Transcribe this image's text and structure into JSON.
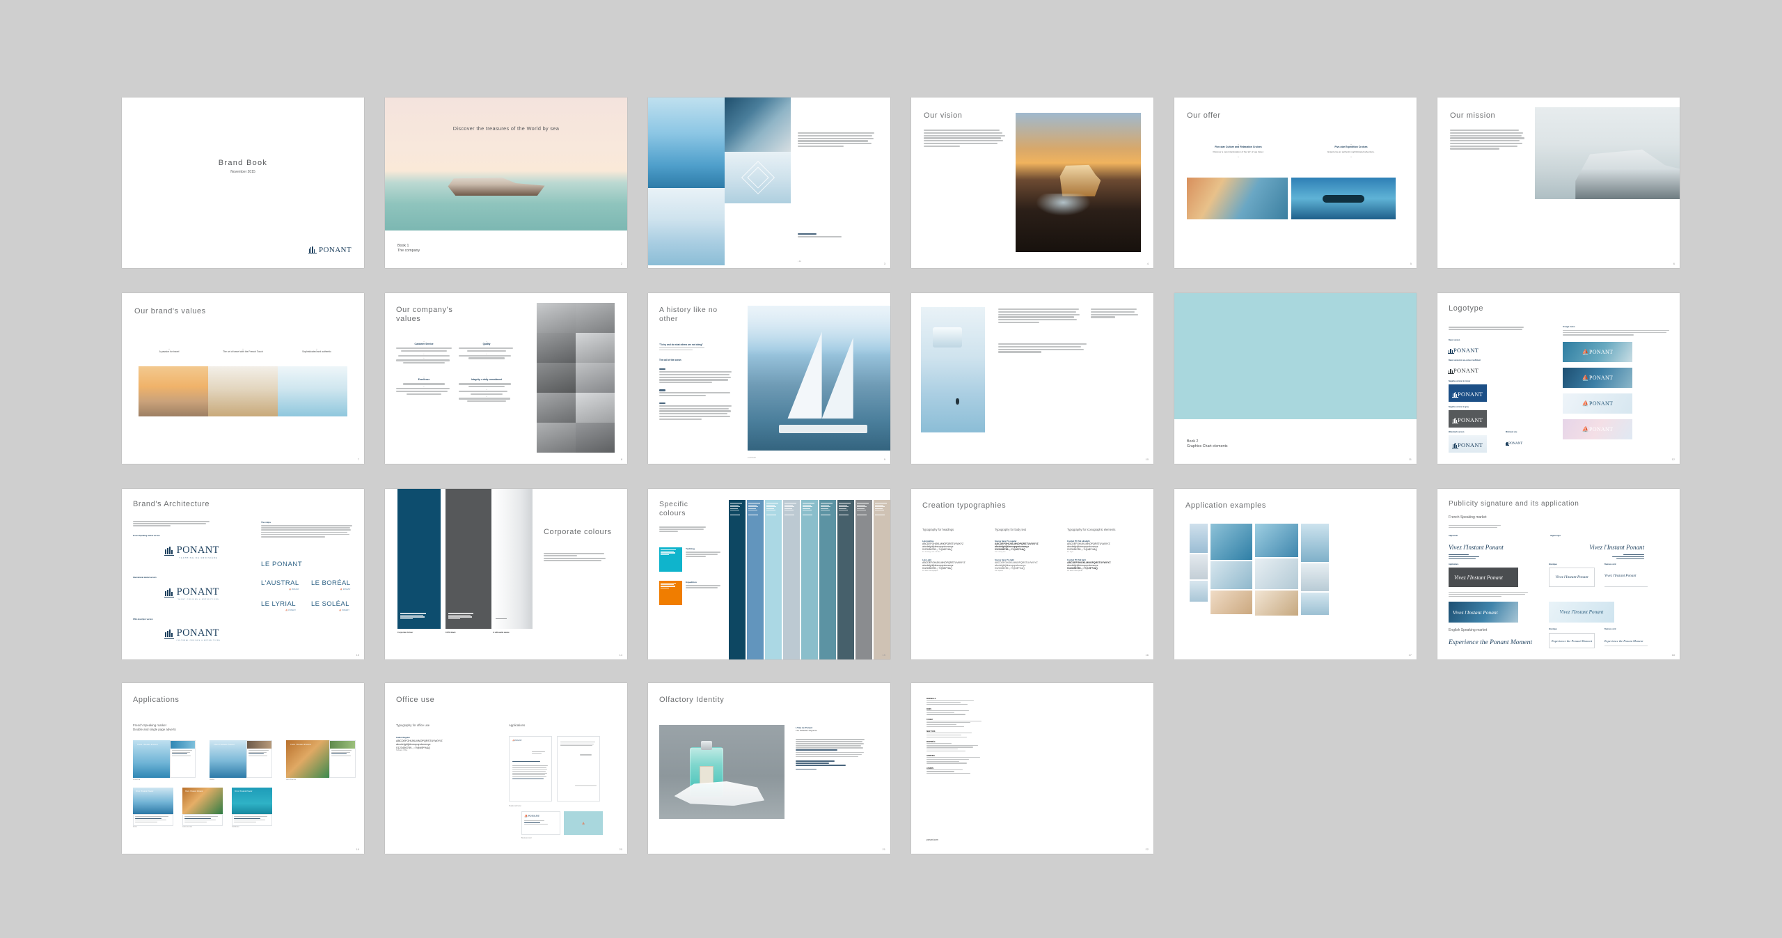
{
  "document": {
    "title": "Brand Book",
    "date": "November 2015",
    "brand": "PONANT",
    "accent_blue": "#1b3e5c",
    "accent_cyan": "#0fb4cc",
    "accent_orange": "#f07d00",
    "accent_lightblue": "#a9d7dd",
    "page_bg": "#cfcfcf",
    "website": "ponant.com"
  },
  "slides": [
    {
      "n": 1,
      "name": "cover",
      "title": "Brand Book",
      "subtitle": "November 2015",
      "logo": "PONANT",
      "page": ""
    },
    {
      "n": 2,
      "name": "book-1-divider",
      "tagline": "Discover the treasures of the World by sea",
      "book_label": "Book 1",
      "book_title": "The company",
      "page": "2"
    },
    {
      "n": 3,
      "name": "imagery-mosaic",
      "body": "PONANT offers a unique way of travelling: small capacity luxury yachts sailing to the most beautiful destinations in the world, combining comfort, design and the French Touch.",
      "caption": "Le monde",
      "page": "3"
    },
    {
      "n": 4,
      "name": "our-vision",
      "title": "Our vision",
      "body": "To become for France and our international target markets the benchmark for a new style of luxury cruise. In the spirit of a 'Yacht Cruise' they stand out for quality and a varied, carefully thought-out programme of exceptional voyages at sea.",
      "page": "4"
    },
    {
      "n": 5,
      "name": "our-offer",
      "title": "Our offer",
      "columns": [
        {
          "heading": "Five-star Culture and Relaxation Cruises",
          "body": "Discover a new interpretation of the 'art' of sea travel."
        },
        {
          "heading": "Five-star Expedition Cruises",
          "body": "Experience an authentic sophisticated adventure."
        }
      ],
      "page": "5"
    },
    {
      "n": 6,
      "name": "our-mission",
      "title": "Our mission",
      "body": "Offer passengers an opportunity to 'Discover the treasures of the World by sea' aboard small capacity luxury yachts, accompanied by experts passionate about what they do, in a five-star environment combining comfort, design and the French Touch, a certain 'art de vivre à la française'.",
      "page": "6"
    },
    {
      "n": 7,
      "name": "our-brands-values",
      "title": "Our brand's values",
      "values": [
        "A passion for travel",
        "The art of travel with the French Touch",
        "Sophisticated and authentic"
      ],
      "page": "7"
    },
    {
      "n": 8,
      "name": "our-companys-values",
      "title": "Our company's values",
      "values": [
        {
          "heading": "Customer Service",
          "items": [
            "Ensuring customer satisfaction by listening and exceeding their expectations.",
            "Offering the service and experience we'd wish to receive.",
            "Providing a reliable and consistently high quality service for frequent travellers (repeat and loyalty programmes)."
          ]
        },
        {
          "heading": "Quality",
          "items": [
            "Constantly striving for excellence in everything we do and expect of each other.",
            "Paying attention to and belief in detail which makes the difference."
          ]
        },
        {
          "heading": "Excellence",
          "items": [
            "Employing the best people.",
            "Investing in developing their potential (career, training, recognition, rewarding performance and sharing success)."
          ]
        },
        {
          "heading": "Integrity: a daily commitment",
          "items": [
            "Behaving in an ethical and responsible manner for all our crew.",
            "Fully respecting our passengers and the ocean.",
            "Contributing to protecting the environment and local communities."
          ]
        }
      ],
      "page": "8"
    },
    {
      "n": 9,
      "name": "a-history-like-no-other",
      "title": "A history like no other",
      "quote": "\"To try and do what others are not doing\"",
      "quote_attribution": "J.E. Olivier (1937 – 2010), the original founder and prime explorer",
      "section": "The call of the ocean",
      "timeline": [
        {
          "year": "1988",
          "text": "Created in 1988 by a few PONANT officers led by former naval Captains, the company launched its first cruise ship, Le Ponant, a four-masted sailing yacht. The idea was to offer an alternative to the existing mass market offer and provide a unique experience at sea."
        },
        {
          "year": "1993",
          "text": "In 1993, the company acquired the Song of Flower and its Mediterranean and Far East itineraries."
        },
        {
          "year": "2004",
          "text": "Three ships joined the fleet between 2010 and 2013: Le Boréal, L'Austral and Le Soléal. In 2015 Le Lyrial joined the fleet, reinforcing the yacht-cruise concept designed for elegance and comfort. The company continued to grow with its purpose-built fleet of expedition yachts, opening new destinations including the Arctic and Antarctic."
        }
      ],
      "caption": "Le Ponant",
      "page": "9"
    },
    {
      "n": 10,
      "name": "expedition-spread",
      "body": "Expedition cruises take you to the furthest reaches of the planet, to destinations where few travellers venture, in the heart of unspoiled nature and in complete comfort.",
      "page": "10"
    },
    {
      "n": 11,
      "name": "book-2-divider",
      "book_label": "Book 2",
      "book_title": "Graphics Chart elements",
      "page": "11"
    },
    {
      "n": 12,
      "name": "logotype",
      "title": "Logotype",
      "intro": "The logotype represents the image of the brand. It is an indispensable element of the brand's identity. Its proportions, positioning and colours of the mark are predefined and must never be altered.",
      "variants": [
        "Basic version",
        "Basic version in one-colour coefficient",
        "Negative version in colour",
        "Negative version in grey",
        "Watermark version",
        "Minimum size"
      ],
      "usage_heading": "Usage rules",
      "usage_body": "To ensure the image works best, the logotype is placed in the top right-hand side of the layout, and in no case over a texture or image where the logotype would be difficult to read. The logotype must always be legible and the area must be clear.",
      "page": "12"
    },
    {
      "n": 13,
      "name": "brands-architecture",
      "title": "Brand's Architecture",
      "intro": "The specific combinations accompanying the main signature are defined alongside the brand, and vary according to the market and the final designs. Each combination must be used without deterioration.",
      "lockups": [
        {
          "label": "French Speaking market version",
          "descriptor": "YACHTING DE CROISIÈRE"
        },
        {
          "label": "International market version",
          "descriptor": "YACHT CRUISES & EXPEDITIONS"
        },
        {
          "label": "Offer descriptor version",
          "descriptor": "CULTURAL CRUISES & EXPEDITIONS"
        }
      ],
      "ships_heading": "The ships",
      "ships_body": "Besides the brand, the ships have their own identity. Each of them is associated with the PONANT signature and the yachting universe. The PONANT name appearing on board designates the whole fleet, and the descriptor used alongside each ship identifies the type of cruise.",
      "ships": [
        "LE PONANT",
        "L'AUSTRAL",
        "LE BORÉAL",
        "LE LYRIAL",
        "LE SOLÉAL"
      ],
      "page": "13"
    },
    {
      "n": 14,
      "name": "corporate-colours",
      "title": "Corporate colours",
      "body": "The corporate colour for the PONANT logotype is Pantone 7692 graphite and blue-grey. These colours are reinforced with 100% black and a white space, for all the references in a graphic and monochrome, 80% or mechanical.",
      "swatches": [
        {
          "name": "Corporate Colour",
          "spec": "Pantone 7692\nCMYK 100 / 56 / 17 / 44\nRGB 0 / 78 / 113\n#004E71",
          "hex": "#0d4d6e"
        },
        {
          "name": "100% black",
          "spec": "Pantone Black\nCMYK 0 / 0 / 0 / 100\nRGB 35 / 31 / 32\n#231F20",
          "hex": "#555557"
        },
        {
          "name": "A silhouette aware",
          "spec": "Gradient",
          "hex": "#ffffff"
        }
      ],
      "page": "14"
    },
    {
      "n": 15,
      "name": "specific-colours",
      "title": "Specific colours",
      "body": "Two other colours are to be highlighted and the two for a specific expedition or cruise activity, corresponding to the offer.",
      "named": [
        {
          "name": "Yachting",
          "body": "Reserved for the Yachting universe with mixed guides for the brand signature.",
          "hex": "#0fb4cc",
          "spec": "Pantone 3125\nCMYK 78 / 0 / 19 / 0\nRGB 0 / 180 / 204\n#00B4CC"
        },
        {
          "name": "Expedition",
          "body": "Reserved for the Expedition universe with mixed guides and the expedition tones.",
          "hex": "#f07d00",
          "spec": "Pantone 151\nCMYK 0 / 56 / 100 / 0\nRGB 240 / 125 / 0\n#F07D00"
        }
      ],
      "palette": [
        {
          "hex": "#0d4762",
          "label": "PANTONE 7700"
        },
        {
          "hex": "#6295bd",
          "label": "PANTONE 646"
        },
        {
          "hex": "#abd8e4",
          "label": "PANTONE 636"
        },
        {
          "hex": "#bcc9d2",
          "label": "PANTONE 5435"
        },
        {
          "hex": "#8abecb",
          "label": "PANTONE 550"
        },
        {
          "hex": "#5c93a3",
          "label": "PANTONE 5483"
        },
        {
          "hex": "#46606b",
          "label": "PANTONE 5463"
        },
        {
          "hex": "#8a8c8f",
          "label": "COOL GREY 8"
        },
        {
          "hex": "#cfc2b4",
          "label": "PANTONE 7528"
        }
      ],
      "page": "15"
    },
    {
      "n": 16,
      "name": "creation-typographies",
      "title": "Creation typographies",
      "columns": [
        {
          "heading": "Typography for headings",
          "fonts": [
            {
              "name": "Lato Hairline",
              "upper": "ABCDEFGHIJKLMNOPQRSTUVWXYZ",
              "lower": "abcdefghijklmnopqrstuvwxyz",
              "digits": "0123456789.,;:?!@#$*%&()",
              "note": "For headings and sub-titles"
            },
            {
              "name": "Lato Light",
              "upper": "ABCDEFGHIJKLMNOPQRSTUVWXYZ",
              "lower": "abcdefghijklmnopqrstuvwxyz",
              "digits": "0123456789.,;:?!@#$*%&()",
              "note": "For titles and highlights"
            }
          ]
        },
        {
          "heading": "Typography for body text",
          "fonts": [
            {
              "name": "Source Sans Pro regular",
              "upper": "ABCDEFGHIJKLMNOPQRSTUVWXYZ",
              "lower": "abcdefghijklmnopqrstuvwxyz",
              "digits": "0123456789.,;:?!@#$*%&()",
              "note": "For running text"
            },
            {
              "name": "Source Sans Pro light",
              "upper": "ABCDEFGHIJKLMNOPQRSTUVWXYZ",
              "lower": "abcdefghijklmnopqrstuvwxyz",
              "digits": "0123456789.,;:?!@#$*%&()",
              "note": "For captions"
            }
          ]
        },
        {
          "heading": "Typography for iconographic elements",
          "fonts": [
            {
              "name": "Conduit ITC Std ultralight",
              "upper": "ABCDEFGHIJKLMNOPQRSTUVWXYZ",
              "lower": "abcdefghijklmnopqrstuvwxyz",
              "digits": "0123456789.,;:?!@#$*%&()",
              "note": "For logos"
            },
            {
              "name": "Conduit ITC Std light",
              "upper": "ABCDEFGHIJKLMNOPQRSTUVWXYZ",
              "lower": "abcdefghijklmnopqrstuvwxyz",
              "digits": "0123456789.,;:?!@#$*%&()",
              "note": "For labels and legends"
            }
          ]
        }
      ],
      "page": "16"
    },
    {
      "n": 17,
      "name": "application-examples",
      "title": "Application examples",
      "page": "17"
    },
    {
      "n": 18,
      "name": "publicity-signature",
      "title": "Publicity signature and its application",
      "fr_heading": "French Speaking market",
      "fr_note": "The full text of the signature placed with the logotype is used to reinforce the brand signature.",
      "fr_signature": "Vivez l'Instant Ponant",
      "labels": [
        "Aligned left",
        "Aligned right",
        "Applications",
        "Envelopes",
        "Business card"
      ],
      "note2": "The use of the signature with the logotype on a mark. It must be placed in the graphic area and in these cases where it is insufficiently and if the signature with the logotype would be alter. The graphic rules must always be taken into consideration.",
      "en_heading": "English Speaking market",
      "en_signature": "Experience the Ponant Moment",
      "page": "18"
    },
    {
      "n": 19,
      "name": "applications",
      "title": "Applications",
      "sub1": "French Speaking market",
      "sub2": "Double and single page adverts",
      "captions": [
        "Antarctica",
        "Alaska",
        "Latin America",
        "Arctic",
        "Latin America",
        "Caribbean"
      ],
      "page": "19"
    },
    {
      "n": 20,
      "name": "office-use",
      "title": "Office use",
      "left_heading": "Typography for office use",
      "font_name": "Calibri Regular",
      "font_upper": "ABCDEFGHIJKLMNOPQRSTUVWXYZ",
      "font_lower": "abcdefghijklmnopqrstuvwxyz",
      "font_digits": "0123456789.,;:?!@#$*%&()",
      "font_note": "Software: Office",
      "right_heading": "Applications",
      "caption1": "Header and letter",
      "caption2": "Business card",
      "page": "20"
    },
    {
      "n": 21,
      "name": "olfactory-identity",
      "title": "Olfactory Identity",
      "product": "L'Eau de Ponant",
      "product_sub": "The PONANT fragrance",
      "body": "A fresh aquatic and marine composition, with a hint of sophistication, unique and glamourous: an accessory to carry gently by the sea and on the farthest shores. An exclusive scent signature to PONANT, the signature fragrance. The sea, its navigators and its unique perspectives: PONANT crossed all the senses of its signature fragrance from its perfume manufacturers. The scent notes and effects are composed as a fresh eau de toilette, with a luminous top note, jasmine, lily and fig, amber, cedar wood and ambergris.",
      "notes": [
        {
          "label": "Top notes:",
          "value": "bergamot, lemon"
        },
        {
          "label": "Heart notes:",
          "value": "jasmine, rose"
        },
        {
          "label": "Base notes:",
          "value": "cedar, amber, white tea notes"
        }
      ],
      "footer": "Woman & Man",
      "page": "21"
    },
    {
      "n": 22,
      "name": "contacts",
      "offices": [
        {
          "city": "MARSEILLE",
          "lines": [
            "Le Ponant de France",
            "Marseille 13008",
            "T. +33 4 88 66 64 00"
          ]
        },
        {
          "city": "PARIS",
          "lines": [
            "8 rue Volney",
            "Paris 75002",
            "T. +33 1 44 94 69 00"
          ]
        },
        {
          "city": "SYDNEY",
          "lines": [
            "Level 1, 189 Kent Street",
            "Sydney NSW 2000",
            "T. +61 2 8006 0060"
          ]
        },
        {
          "city": "NEW YORK",
          "lines": [
            "420 Lexington Avenue",
            "New York NY 10170",
            "T. +1 888 400 1082"
          ]
        },
        {
          "city": "MONTRÉAL",
          "lines": [
            "1001 boulevard",
            "De Maisonneuve Ouest",
            "Montréal H3A 3C8",
            "T. +1 844 552 3773"
          ]
        },
        {
          "city": "HAMBURG",
          "lines": [
            "Ballindamm 17",
            "Hamburg 20095",
            "T. +49 40 300 6590"
          ]
        },
        {
          "city": "LONDON",
          "lines": [
            "Pall Mall",
            "London SW1Y",
            "T. +44 20 7292 3288"
          ]
        }
      ],
      "website": "ponant.com",
      "page": "22"
    }
  ]
}
